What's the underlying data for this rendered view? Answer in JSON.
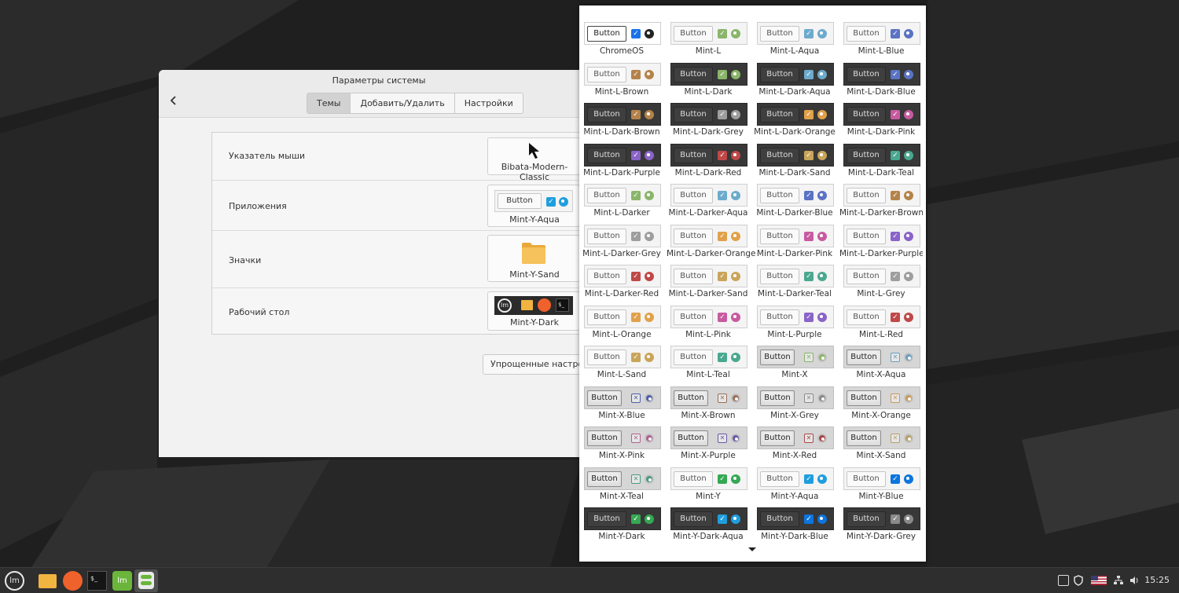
{
  "settings_window": {
    "title": "Параметры системы",
    "tabs": [
      {
        "label": "Темы",
        "active": true
      },
      {
        "label": "Добавить/Удалить",
        "active": false
      },
      {
        "label": "Настройки",
        "active": false
      }
    ],
    "rows": [
      {
        "label": "Указатель мыши",
        "value": "Bibata-Modern-Classic"
      },
      {
        "label": "Приложения",
        "value": "Mint-Y-Aqua",
        "preview_button": "Button"
      },
      {
        "label": "Значки",
        "value": "Mint-Y-Sand"
      },
      {
        "label": "Рабочий стол",
        "value": "Mint-Y-Dark"
      }
    ],
    "simple_settings_button": "Упрощенные настройки"
  },
  "theme_popup": {
    "button_text": "Button",
    "themes": [
      {
        "name": "ChromeOS",
        "style": "chrome",
        "accent": "#1a73e8"
      },
      {
        "name": "Mint-L",
        "style": "light",
        "accent": "#8ab56a"
      },
      {
        "name": "Mint-L-Aqua",
        "style": "light",
        "accent": "#6cabcd"
      },
      {
        "name": "Mint-L-Blue",
        "style": "light",
        "accent": "#5b73c4"
      },
      {
        "name": "Mint-L-Brown",
        "style": "light",
        "accent": "#b5834a"
      },
      {
        "name": "Mint-L-Dark",
        "style": "dark",
        "accent": "#8ab56a"
      },
      {
        "name": "Mint-L-Dark-Aqua",
        "style": "dark",
        "accent": "#6cabcd"
      },
      {
        "name": "Mint-L-Dark-Blue",
        "style": "dark",
        "accent": "#5b73c4"
      },
      {
        "name": "Mint-L-Dark-Brown",
        "style": "dark",
        "accent": "#b5834a"
      },
      {
        "name": "Mint-L-Dark-Grey",
        "style": "dark",
        "accent": "#9e9e9e"
      },
      {
        "name": "Mint-L-Dark-Orange",
        "style": "dark",
        "accent": "#e1a14a"
      },
      {
        "name": "Mint-L-Dark-Pink",
        "style": "dark",
        "accent": "#c85ba0"
      },
      {
        "name": "Mint-L-Dark-Purple",
        "style": "dark",
        "accent": "#8a64c8"
      },
      {
        "name": "Mint-L-Dark-Red",
        "style": "dark",
        "accent": "#c04848"
      },
      {
        "name": "Mint-L-Dark-Sand",
        "style": "dark",
        "accent": "#c9a55a"
      },
      {
        "name": "Mint-L-Dark-Teal",
        "style": "dark",
        "accent": "#4aa890"
      },
      {
        "name": "Mint-L-Darker",
        "style": "light",
        "accent": "#8ab56a"
      },
      {
        "name": "Mint-L-Darker-Aqua",
        "style": "light",
        "accent": "#6cabcd"
      },
      {
        "name": "Mint-L-Darker-Blue",
        "style": "light",
        "accent": "#5b73c4"
      },
      {
        "name": "Mint-L-Darker-Brown",
        "style": "light",
        "accent": "#b5834a"
      },
      {
        "name": "Mint-L-Darker-Grey",
        "style": "light",
        "accent": "#9e9e9e"
      },
      {
        "name": "Mint-L-Darker-Orange",
        "style": "light",
        "accent": "#e1a14a"
      },
      {
        "name": "Mint-L-Darker-Pink",
        "style": "light",
        "accent": "#c85ba0"
      },
      {
        "name": "Mint-L-Darker-Purple",
        "style": "light",
        "accent": "#8a64c8"
      },
      {
        "name": "Mint-L-Darker-Red",
        "style": "light",
        "accent": "#c04848"
      },
      {
        "name": "Mint-L-Darker-Sand",
        "style": "light",
        "accent": "#c9a55a"
      },
      {
        "name": "Mint-L-Darker-Teal",
        "style": "light",
        "accent": "#4aa890"
      },
      {
        "name": "Mint-L-Grey",
        "style": "light",
        "accent": "#9e9e9e"
      },
      {
        "name": "Mint-L-Orange",
        "style": "light",
        "accent": "#e1a14a"
      },
      {
        "name": "Mint-L-Pink",
        "style": "light",
        "accent": "#c85ba0"
      },
      {
        "name": "Mint-L-Purple",
        "style": "light",
        "accent": "#8a64c8"
      },
      {
        "name": "Mint-L-Red",
        "style": "light",
        "accent": "#c04848"
      },
      {
        "name": "Mint-L-Sand",
        "style": "light",
        "accent": "#c9a55a"
      },
      {
        "name": "Mint-L-Teal",
        "style": "light",
        "accent": "#4aa890"
      },
      {
        "name": "Mint-X",
        "style": "mintx",
        "accent": "#8ab56a"
      },
      {
        "name": "Mint-X-Aqua",
        "style": "mintx",
        "accent": "#6c9ec0"
      },
      {
        "name": "Mint-X-Blue",
        "style": "mintx",
        "accent": "#4d5fa8"
      },
      {
        "name": "Mint-X-Brown",
        "style": "mintx",
        "accent": "#9a7258"
      },
      {
        "name": "Mint-X-Grey",
        "style": "mintx",
        "accent": "#8a8a8a"
      },
      {
        "name": "Mint-X-Orange",
        "style": "mintx",
        "accent": "#c89a58"
      },
      {
        "name": "Mint-X-Pink",
        "style": "mintx",
        "accent": "#b0608e"
      },
      {
        "name": "Mint-X-Purple",
        "style": "mintx",
        "accent": "#6a5aa8"
      },
      {
        "name": "Mint-X-Red",
        "style": "mintx",
        "accent": "#a84848"
      },
      {
        "name": "Mint-X-Sand",
        "style": "mintx",
        "accent": "#b8a068"
      },
      {
        "name": "Mint-X-Teal",
        "style": "mintx",
        "accent": "#4a9a80"
      },
      {
        "name": "Mint-Y",
        "style": "light",
        "accent": "#35a854"
      },
      {
        "name": "Mint-Y-Aqua",
        "style": "light",
        "accent": "#1f9ede"
      },
      {
        "name": "Mint-Y-Blue",
        "style": "light",
        "accent": "#0c75de"
      },
      {
        "name": "Mint-Y-Dark",
        "style": "dark",
        "accent": "#35a854"
      },
      {
        "name": "Mint-Y-Dark-Aqua",
        "style": "dark",
        "accent": "#1f9ede"
      },
      {
        "name": "Mint-Y-Dark-Blue",
        "style": "dark",
        "accent": "#0c75de"
      },
      {
        "name": "Mint-Y-Dark-Grey",
        "style": "dark",
        "accent": "#8a8a8a"
      }
    ]
  },
  "taskbar": {
    "clock": "15:25",
    "launchers": [
      "menu-icon",
      "files-icon",
      "firefox-icon",
      "terminal-icon",
      "mintinstall-icon",
      "system-settings-icon"
    ]
  }
}
